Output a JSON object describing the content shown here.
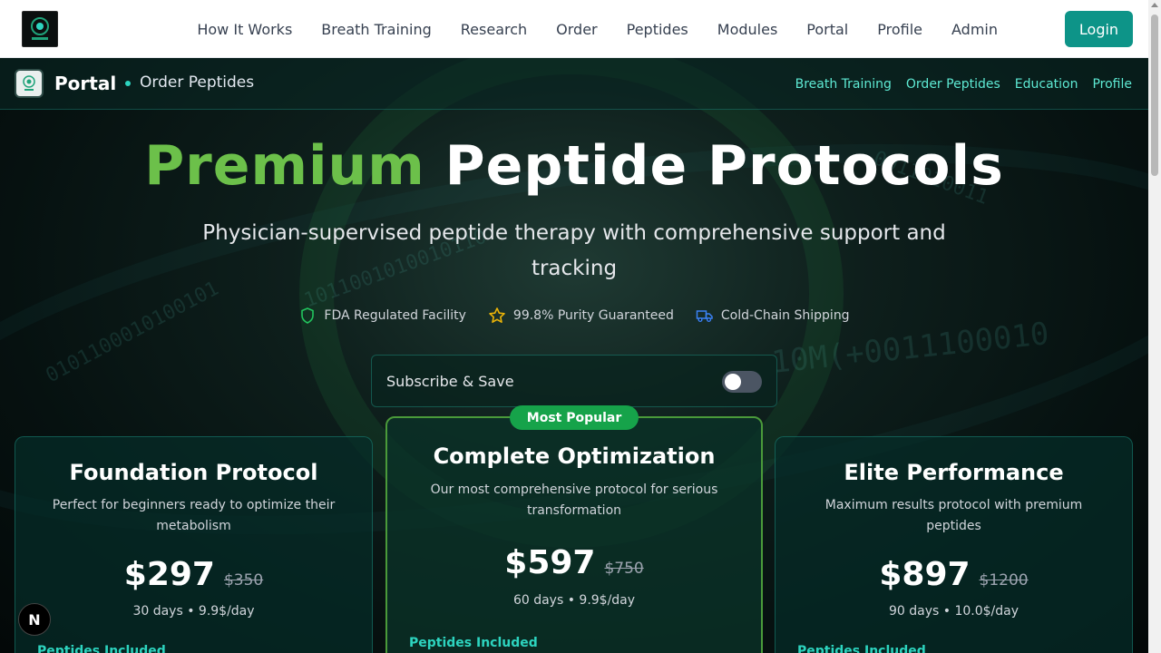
{
  "topnav": {
    "links": [
      "How It Works",
      "Breath Training",
      "Research",
      "Order",
      "Peptides",
      "Modules",
      "Portal",
      "Profile",
      "Admin"
    ],
    "login_label": "Login"
  },
  "subheader": {
    "title": "Portal",
    "subtitle": "Order Peptides",
    "links": [
      "Breath Training",
      "Order Peptides",
      "Education",
      "Profile"
    ]
  },
  "hero": {
    "title_accent": "Premium",
    "title_rest": "Peptide Protocols",
    "subtitle": "Physician-supervised peptide therapy with comprehensive support and tracking",
    "badges": [
      "FDA Regulated Facility",
      "99.8% Purity Guaranteed",
      "Cold-Chain Shipping"
    ],
    "subscribe_label": "Subscribe & Save",
    "subscribe_enabled": false
  },
  "popular_label": "Most Popular",
  "plans": [
    {
      "name": "Foundation Protocol",
      "description": "Perfect for beginners ready to optimize their metabolism",
      "price": "$297",
      "old_price": "$350",
      "duration": "30 days • 9.9$/day",
      "included_label": "Peptides Included"
    },
    {
      "name": "Complete Optimization",
      "description": "Our most comprehensive protocol for serious transformation",
      "price": "$597",
      "old_price": "$750",
      "duration": "60 days • 9.9$/day",
      "included_label": "Peptides Included"
    },
    {
      "name": "Elite Performance",
      "description": "Maximum results protocol with premium peptides",
      "price": "$897",
      "old_price": "$1200",
      "duration": "90 days • 10.0$/day",
      "included_label": "Peptides Included"
    }
  ],
  "dev_badge": "N",
  "colors": {
    "accent_green": "#6cc04a",
    "teal": "#0d9488",
    "teal_light": "#5eead4"
  }
}
